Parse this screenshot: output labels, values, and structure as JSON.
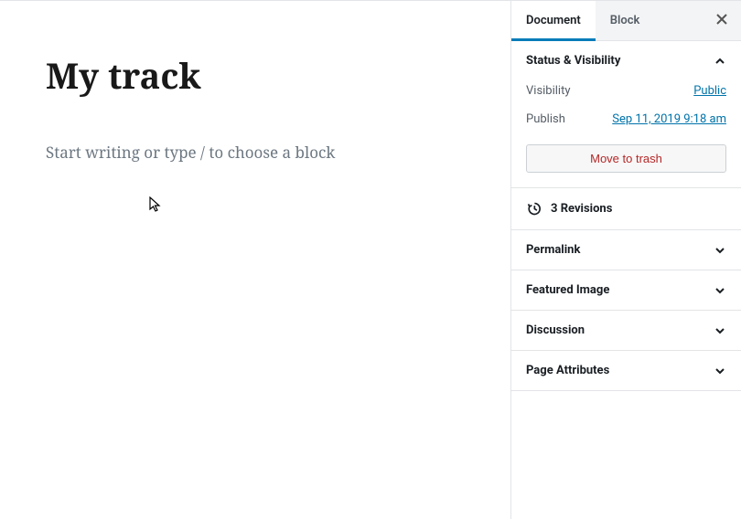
{
  "editor": {
    "title": "My track",
    "block_placeholder": "Start writing or type / to choose a block"
  },
  "sidebar": {
    "tabs": {
      "document": "Document",
      "block": "Block"
    },
    "status_visibility": {
      "title": "Status & Visibility",
      "visibility_label": "Visibility",
      "visibility_value": "Public",
      "publish_label": "Publish",
      "publish_value": "Sep 11, 2019 9:18 am",
      "trash_label": "Move to trash"
    },
    "revisions": {
      "text": "3 Revisions"
    },
    "panels": {
      "permalink": "Permalink",
      "featured_image": "Featured Image",
      "discussion": "Discussion",
      "page_attributes": "Page Attributes"
    }
  }
}
